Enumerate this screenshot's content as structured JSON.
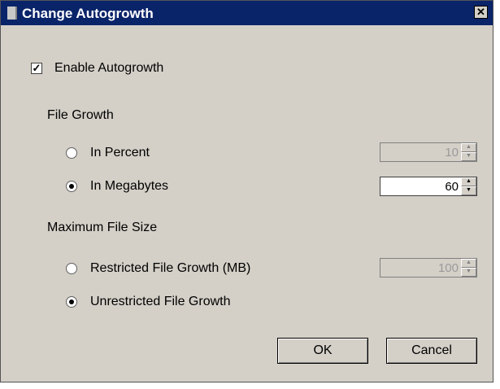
{
  "dialog": {
    "title": "Change Autogrowth",
    "close_glyph": "✕"
  },
  "enable_autogrowth": {
    "label": "Enable Autogrowth",
    "checked": true
  },
  "file_growth": {
    "heading": "File Growth",
    "in_percent": {
      "label": "In Percent",
      "selected": false,
      "value": "10"
    },
    "in_megabytes": {
      "label": "In Megabytes",
      "selected": true,
      "value": "60"
    }
  },
  "max_file_size": {
    "heading": "Maximum File Size",
    "restricted": {
      "label": "Restricted File Growth (MB)",
      "selected": false,
      "value": "100"
    },
    "unrestricted": {
      "label": "Unrestricted File Growth",
      "selected": true
    }
  },
  "buttons": {
    "ok": "OK",
    "cancel": "Cancel"
  }
}
